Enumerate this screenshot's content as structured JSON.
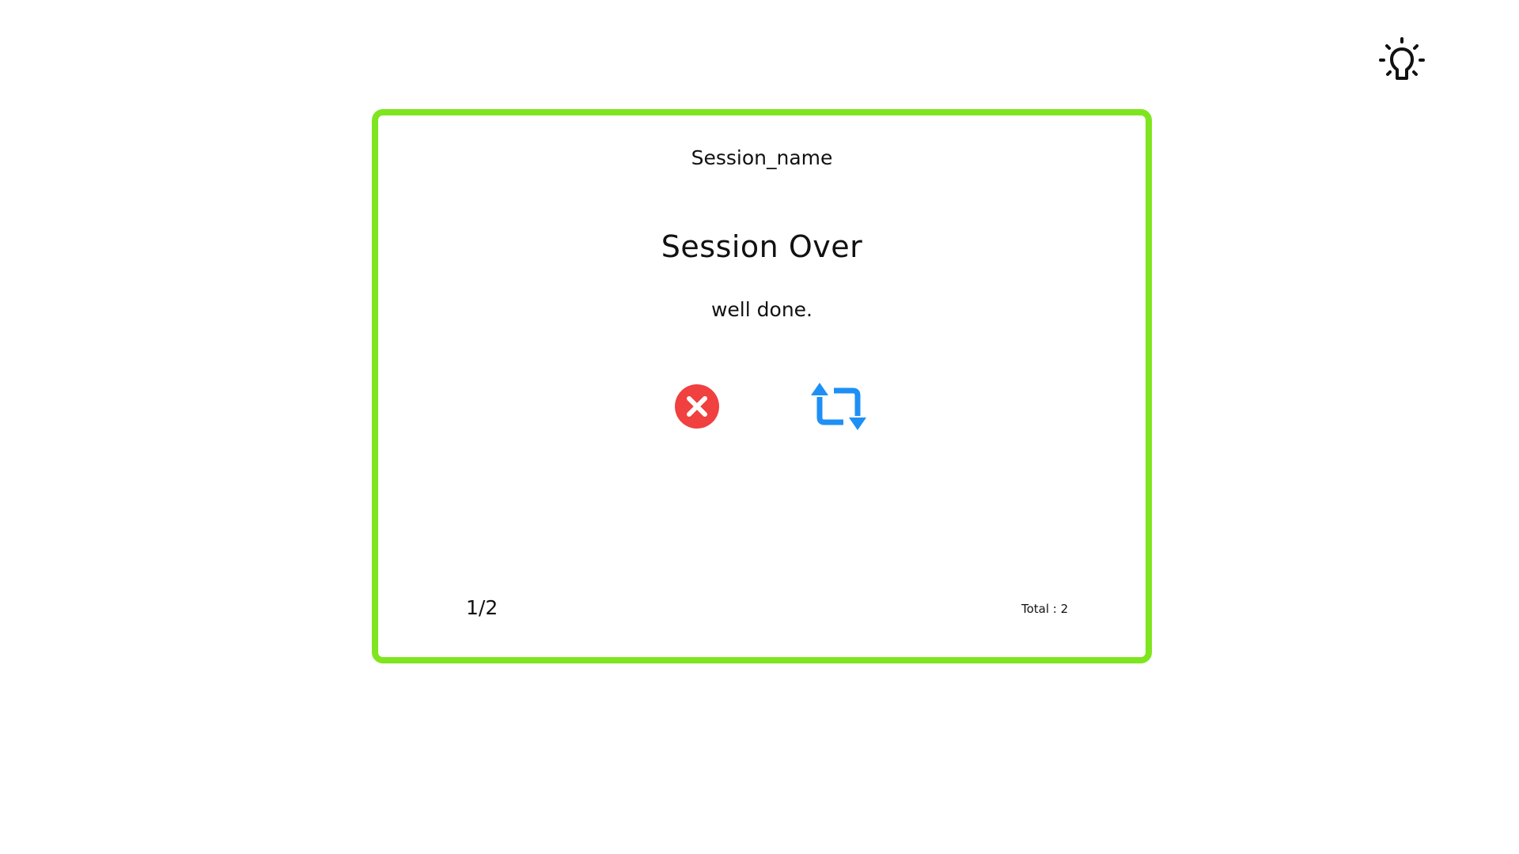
{
  "header": {
    "theme_toggle_icon": "lightbulb-icon"
  },
  "card": {
    "border_color": "#7fe51f",
    "session_name": "Session_name",
    "title": "Session Over",
    "message": "well done.",
    "actions": {
      "close_icon": "close-circle-icon",
      "close_color": "#f04040",
      "restart_icon": "repeat-icon",
      "restart_color": "#1e90f5"
    },
    "progress_text": "1/2",
    "total_text": "Total : 2"
  }
}
